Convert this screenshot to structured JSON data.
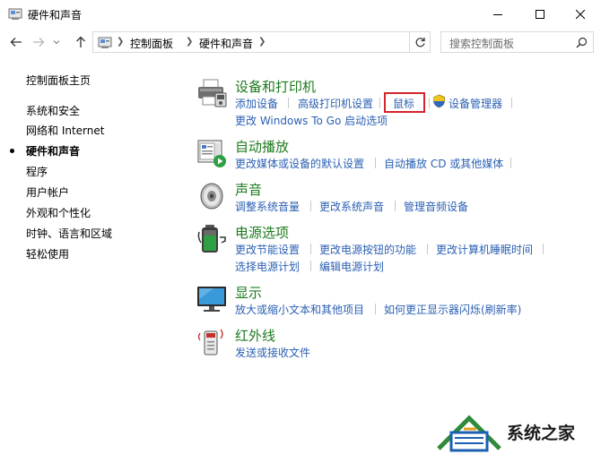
{
  "window": {
    "title": "硬件和声音"
  },
  "address": {
    "crumbs": [
      "控制面板",
      "硬件和声音"
    ]
  },
  "search": {
    "placeholder": "搜索控制面板"
  },
  "sidebar": {
    "items": [
      {
        "label": "控制面板主页",
        "current": false
      },
      {
        "label": "系统和安全",
        "current": false
      },
      {
        "label": "网络和 Internet",
        "current": false
      },
      {
        "label": "硬件和声音",
        "current": true
      },
      {
        "label": "程序",
        "current": false
      },
      {
        "label": "用户帐户",
        "current": false
      },
      {
        "label": "外观和个性化",
        "current": false
      },
      {
        "label": "时钟、语言和区域",
        "current": false
      },
      {
        "label": "轻松使用",
        "current": false
      }
    ]
  },
  "categories": [
    {
      "title": "设备和打印机",
      "icon": "printer-icon",
      "links": [
        "添加设备",
        "高级打印机设置",
        "鼠标",
        "设备管理器",
        "更改 Windows To Go 启动选项"
      ]
    },
    {
      "title": "自动播放",
      "icon": "autoplay-icon",
      "links": [
        "更改媒体或设备的默认设置",
        "自动播放 CD 或其他媒体"
      ]
    },
    {
      "title": "声音",
      "icon": "speaker-icon",
      "links": [
        "调整系统音量",
        "更改系统声音",
        "管理音频设备"
      ]
    },
    {
      "title": "电源选项",
      "icon": "battery-icon",
      "links": [
        "更改节能设置",
        "更改电源按钮的功能",
        "更改计算机睡眠时间",
        "选择电源计划",
        "编辑电源计划"
      ]
    },
    {
      "title": "显示",
      "icon": "monitor-icon",
      "links": [
        "放大或缩小文本和其他项目",
        "如何更正显示器闪烁(刷新率)"
      ]
    },
    {
      "title": "红外线",
      "icon": "infrared-icon",
      "links": [
        "发送或接收文件"
      ]
    }
  ],
  "watermark": {
    "text": "系统之家"
  },
  "colors": {
    "link": "#2b60b3",
    "category_title": "#1e7a1e",
    "highlight": "#d3242b"
  }
}
